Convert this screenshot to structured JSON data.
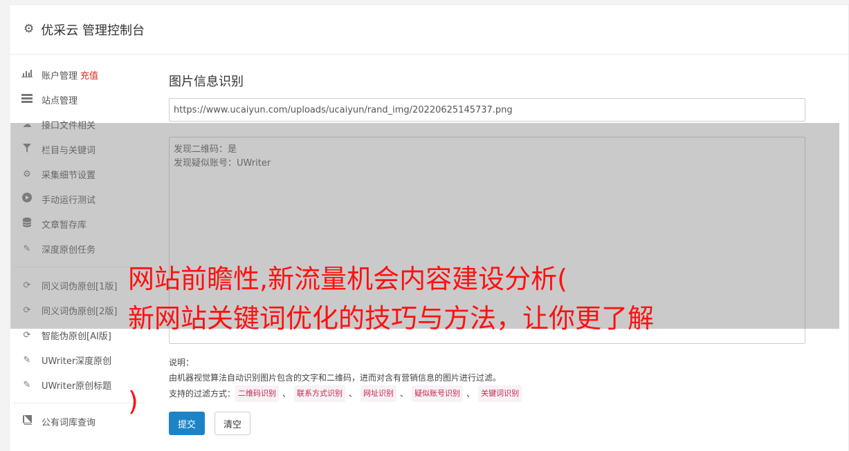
{
  "header": {
    "title": "优采云 管理控制台"
  },
  "sidebar": {
    "items": [
      {
        "label": "账户管理",
        "extra": "充值",
        "icon": "bar-chart-icon"
      },
      {
        "label": "站点管理",
        "icon": "server-icon"
      },
      {
        "label": "接口文件相关",
        "icon": "cloud-upload-icon"
      },
      {
        "label": "栏目与关键词",
        "icon": "filter-icon"
      },
      {
        "label": "采集细节设置",
        "icon": "gears-icon"
      },
      {
        "label": "手动运行测试",
        "icon": "play-circle-icon"
      },
      {
        "label": "文章暂存库",
        "icon": "database-icon"
      },
      {
        "label": "深度原创任务",
        "icon": "edit-icon"
      },
      {
        "label": "同义词伪原创[1版]",
        "icon": "refresh-icon"
      },
      {
        "label": "同义词伪原创[2版]",
        "icon": "refresh-icon"
      },
      {
        "label": "智能伪原创[AI版]",
        "icon": "refresh-icon"
      },
      {
        "label": "UWriter深度原创",
        "icon": "edit-icon"
      },
      {
        "label": "UWriter原创标题",
        "icon": "edit-icon"
      },
      {
        "label": "公有词库查询",
        "icon": "book-icon"
      }
    ]
  },
  "main": {
    "title": "图片信息识别",
    "url_value": "https://www.ucaiyun.com/uploads/ucaiyun/rand_img/20220625145737.png",
    "result_lines": [
      "发现二维码：是",
      "发现疑似账号：UWriter"
    ],
    "note_title": "说明：",
    "note_desc": "由机器视觉算法自动识别图片包含的文字和二维码，进而对含有营销信息的图片进行过滤。",
    "filter_label": "支持的过滤方式：",
    "filters": [
      "二维码识别",
      "联系方式识别",
      "网址识别",
      "疑似账号识别",
      "关键词识别"
    ],
    "filter_sep": "、",
    "submit_label": "提交",
    "clear_label": "清空"
  },
  "overlay_text": {
    "line1": "网站前瞻性,新流量机会内容建设分析(",
    "line2": "新网站关键词优化的技巧与方法，让你更了解",
    "line3": ")"
  },
  "colors": {
    "primary": "#1c84c6",
    "tag_text": "#c7254e",
    "overlay_text": "#ff1010",
    "recharge": "#d9281c"
  }
}
